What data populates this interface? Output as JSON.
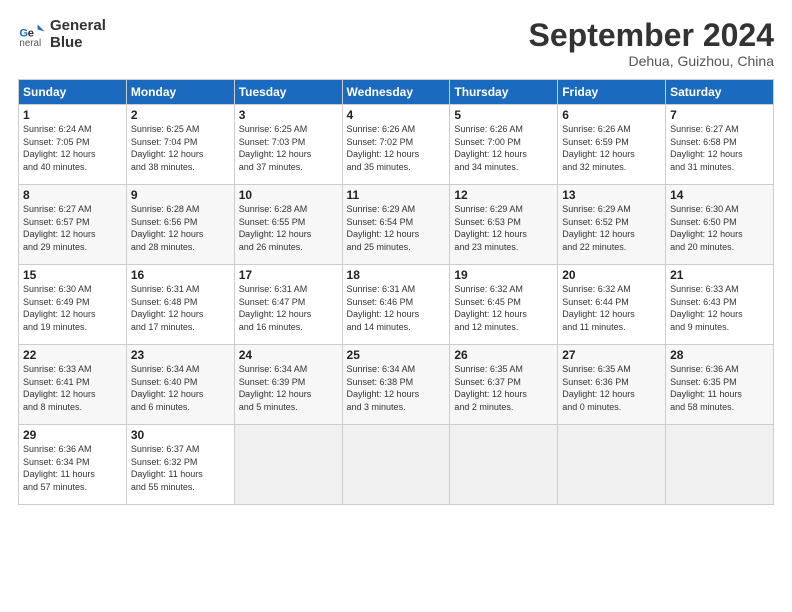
{
  "header": {
    "logo_line1": "General",
    "logo_line2": "Blue",
    "month_title": "September 2024",
    "location": "Dehua, Guizhou, China"
  },
  "days_of_week": [
    "Sunday",
    "Monday",
    "Tuesday",
    "Wednesday",
    "Thursday",
    "Friday",
    "Saturday"
  ],
  "weeks": [
    [
      {
        "num": "1",
        "info": "Sunrise: 6:24 AM\nSunset: 7:05 PM\nDaylight: 12 hours\nand 40 minutes."
      },
      {
        "num": "2",
        "info": "Sunrise: 6:25 AM\nSunset: 7:04 PM\nDaylight: 12 hours\nand 38 minutes."
      },
      {
        "num": "3",
        "info": "Sunrise: 6:25 AM\nSunset: 7:03 PM\nDaylight: 12 hours\nand 37 minutes."
      },
      {
        "num": "4",
        "info": "Sunrise: 6:26 AM\nSunset: 7:02 PM\nDaylight: 12 hours\nand 35 minutes."
      },
      {
        "num": "5",
        "info": "Sunrise: 6:26 AM\nSunset: 7:00 PM\nDaylight: 12 hours\nand 34 minutes."
      },
      {
        "num": "6",
        "info": "Sunrise: 6:26 AM\nSunset: 6:59 PM\nDaylight: 12 hours\nand 32 minutes."
      },
      {
        "num": "7",
        "info": "Sunrise: 6:27 AM\nSunset: 6:58 PM\nDaylight: 12 hours\nand 31 minutes."
      }
    ],
    [
      {
        "num": "8",
        "info": "Sunrise: 6:27 AM\nSunset: 6:57 PM\nDaylight: 12 hours\nand 29 minutes."
      },
      {
        "num": "9",
        "info": "Sunrise: 6:28 AM\nSunset: 6:56 PM\nDaylight: 12 hours\nand 28 minutes."
      },
      {
        "num": "10",
        "info": "Sunrise: 6:28 AM\nSunset: 6:55 PM\nDaylight: 12 hours\nand 26 minutes."
      },
      {
        "num": "11",
        "info": "Sunrise: 6:29 AM\nSunset: 6:54 PM\nDaylight: 12 hours\nand 25 minutes."
      },
      {
        "num": "12",
        "info": "Sunrise: 6:29 AM\nSunset: 6:53 PM\nDaylight: 12 hours\nand 23 minutes."
      },
      {
        "num": "13",
        "info": "Sunrise: 6:29 AM\nSunset: 6:52 PM\nDaylight: 12 hours\nand 22 minutes."
      },
      {
        "num": "14",
        "info": "Sunrise: 6:30 AM\nSunset: 6:50 PM\nDaylight: 12 hours\nand 20 minutes."
      }
    ],
    [
      {
        "num": "15",
        "info": "Sunrise: 6:30 AM\nSunset: 6:49 PM\nDaylight: 12 hours\nand 19 minutes."
      },
      {
        "num": "16",
        "info": "Sunrise: 6:31 AM\nSunset: 6:48 PM\nDaylight: 12 hours\nand 17 minutes."
      },
      {
        "num": "17",
        "info": "Sunrise: 6:31 AM\nSunset: 6:47 PM\nDaylight: 12 hours\nand 16 minutes."
      },
      {
        "num": "18",
        "info": "Sunrise: 6:31 AM\nSunset: 6:46 PM\nDaylight: 12 hours\nand 14 minutes."
      },
      {
        "num": "19",
        "info": "Sunrise: 6:32 AM\nSunset: 6:45 PM\nDaylight: 12 hours\nand 12 minutes."
      },
      {
        "num": "20",
        "info": "Sunrise: 6:32 AM\nSunset: 6:44 PM\nDaylight: 12 hours\nand 11 minutes."
      },
      {
        "num": "21",
        "info": "Sunrise: 6:33 AM\nSunset: 6:43 PM\nDaylight: 12 hours\nand 9 minutes."
      }
    ],
    [
      {
        "num": "22",
        "info": "Sunrise: 6:33 AM\nSunset: 6:41 PM\nDaylight: 12 hours\nand 8 minutes."
      },
      {
        "num": "23",
        "info": "Sunrise: 6:34 AM\nSunset: 6:40 PM\nDaylight: 12 hours\nand 6 minutes."
      },
      {
        "num": "24",
        "info": "Sunrise: 6:34 AM\nSunset: 6:39 PM\nDaylight: 12 hours\nand 5 minutes."
      },
      {
        "num": "25",
        "info": "Sunrise: 6:34 AM\nSunset: 6:38 PM\nDaylight: 12 hours\nand 3 minutes."
      },
      {
        "num": "26",
        "info": "Sunrise: 6:35 AM\nSunset: 6:37 PM\nDaylight: 12 hours\nand 2 minutes."
      },
      {
        "num": "27",
        "info": "Sunrise: 6:35 AM\nSunset: 6:36 PM\nDaylight: 12 hours\nand 0 minutes."
      },
      {
        "num": "28",
        "info": "Sunrise: 6:36 AM\nSunset: 6:35 PM\nDaylight: 11 hours\nand 58 minutes."
      }
    ],
    [
      {
        "num": "29",
        "info": "Sunrise: 6:36 AM\nSunset: 6:34 PM\nDaylight: 11 hours\nand 57 minutes."
      },
      {
        "num": "30",
        "info": "Sunrise: 6:37 AM\nSunset: 6:32 PM\nDaylight: 11 hours\nand 55 minutes."
      },
      {
        "num": "",
        "info": ""
      },
      {
        "num": "",
        "info": ""
      },
      {
        "num": "",
        "info": ""
      },
      {
        "num": "",
        "info": ""
      },
      {
        "num": "",
        "info": ""
      }
    ]
  ]
}
